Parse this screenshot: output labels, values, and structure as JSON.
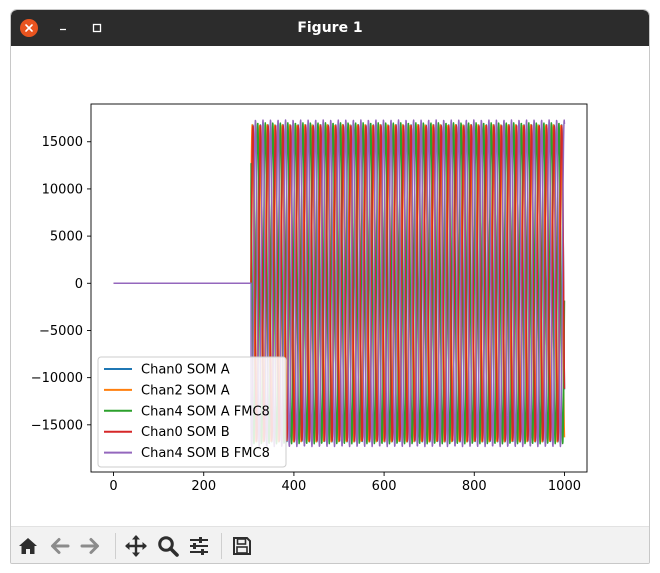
{
  "window": {
    "title": "Figure 1",
    "close_icon": "close-icon",
    "minimize_icon": "minimize-icon",
    "maximize_icon": "maximize-icon"
  },
  "toolbar": {
    "buttons": [
      {
        "name": "home",
        "icon": "home-icon"
      },
      {
        "name": "back",
        "icon": "arrow-left-icon"
      },
      {
        "name": "forward",
        "icon": "arrow-right-icon"
      },
      {
        "name": "pan",
        "icon": "move-icon"
      },
      {
        "name": "zoom",
        "icon": "magnifier-icon"
      },
      {
        "name": "configure",
        "icon": "sliders-icon"
      },
      {
        "name": "save",
        "icon": "floppy-icon"
      }
    ]
  },
  "chart_data": {
    "type": "line",
    "title": "",
    "xlabel": "",
    "ylabel": "",
    "xlim": [
      -50,
      1050
    ],
    "ylim": [
      -20000,
      19000
    ],
    "xticks": [
      0,
      200,
      400,
      600,
      800,
      1000
    ],
    "yticks": [
      -15000,
      -10000,
      -5000,
      0,
      5000,
      10000,
      15000
    ],
    "xtick_labels": [
      "0",
      "200",
      "400",
      "600",
      "800",
      "1000"
    ],
    "ytick_labels": [
      "−15000",
      "−10000",
      "−5000",
      "0",
      "5000",
      "10000",
      "15000"
    ],
    "legend_placement": "lower left",
    "signal": {
      "x_start": 0,
      "x_end": 1000,
      "onset_x": 305,
      "flat_value": 0,
      "amplitude": 17000,
      "period": 16.7
    },
    "series": [
      {
        "name": "Chan0 SOM A",
        "color": "#1f77b4",
        "amplitude": 16800,
        "phase": 0.0
      },
      {
        "name": "Chan2 SOM A",
        "color": "#ff7f0e",
        "amplitude": 16800,
        "phase": 0.6
      },
      {
        "name": "Chan4 SOM A FMC8",
        "color": "#2ca02c",
        "amplitude": 17000,
        "phase": 2.3
      },
      {
        "name": "Chan0 SOM B",
        "color": "#d62728",
        "amplitude": 16700,
        "phase": 0.0
      },
      {
        "name": "Chan4 SOM B FMC8",
        "color": "#9467bd",
        "amplitude": 17300,
        "phase": 4.2
      }
    ]
  }
}
